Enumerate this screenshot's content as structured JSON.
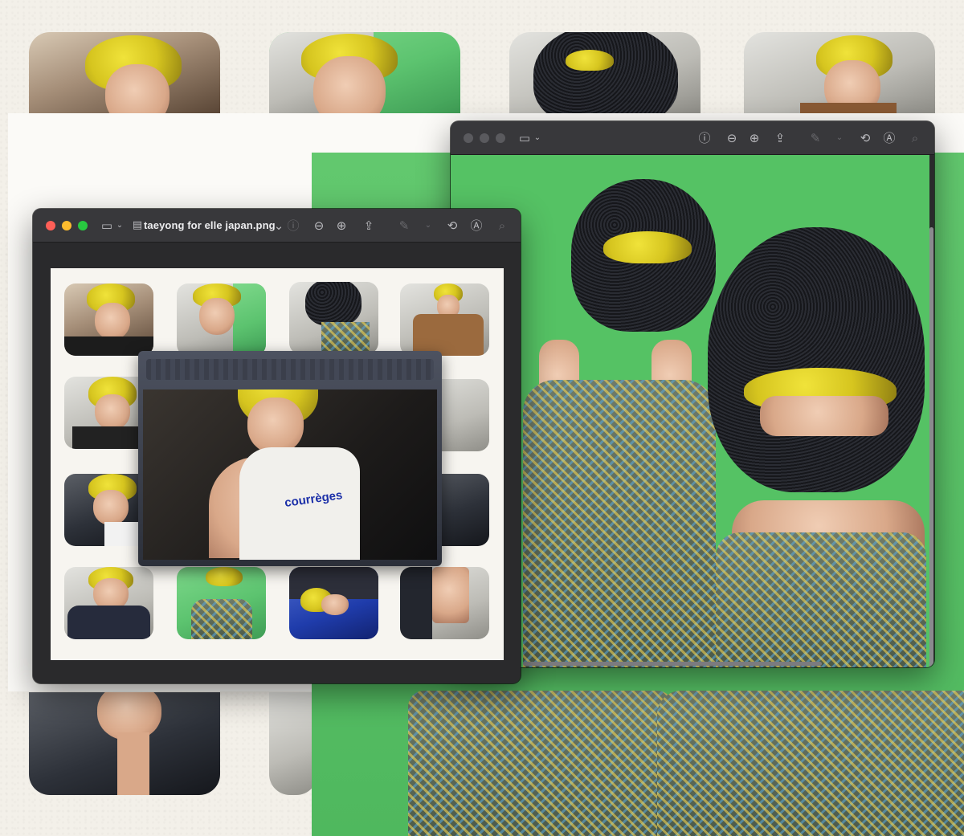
{
  "left_window": {
    "filename": "taeyong for elle japan.png",
    "traffic_lights": {
      "close": "#ff5f57",
      "minimize": "#febc2e",
      "zoom": "#28c840"
    },
    "toolbar_icons": [
      "sidebar-icon",
      "document-icon",
      "chevron-down-icon",
      "info-icon",
      "zoom-out-icon",
      "zoom-in-icon",
      "share-icon",
      "markup-pen-icon",
      "chevron-down-icon",
      "rotate-icon",
      "annotate-icon",
      "search-icon"
    ]
  },
  "right_window": {
    "traffic_lights": {
      "close": "#5a5a5e",
      "minimize": "#5a5a5e",
      "zoom": "#5a5a5e"
    },
    "toolbar_icons": [
      "sidebar-icon",
      "chevron-down-icon",
      "info-icon",
      "zoom-out-icon",
      "zoom-in-icon",
      "share-icon",
      "markup-pen-icon",
      "chevron-down-icon",
      "rotate-icon",
      "annotate-icon",
      "search-icon"
    ]
  },
  "overlay_photo": {
    "shirt_text": "courrèges"
  },
  "colors": {
    "backdrop_green": "#55c264",
    "paper": "#f3f0e9",
    "window_chrome": "#38383b"
  }
}
